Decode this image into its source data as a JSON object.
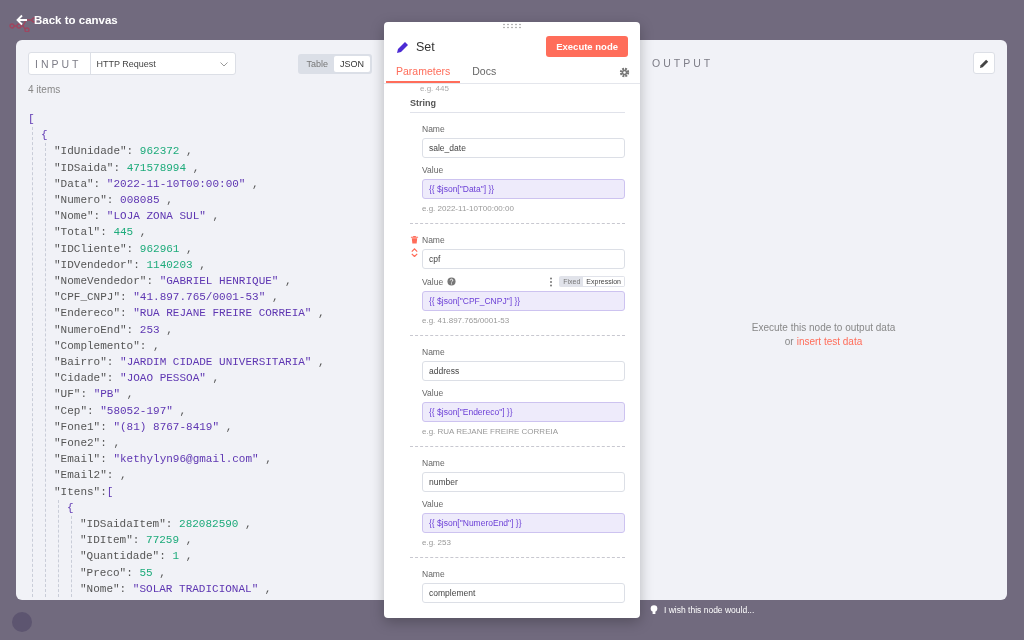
{
  "top_bar": {
    "back_label": "Back to canvas"
  },
  "input": {
    "label": "INPUT",
    "source": "HTTP Request",
    "views": [
      {
        "label": "Table",
        "selected": false
      },
      {
        "label": "JSON",
        "selected": true
      }
    ],
    "count": "4 items",
    "json_view": {
      "open": "[",
      "children": [
        {
          "open": "{",
          "children": [
            {
              "key": "\"IdUnidade\":",
              "value": "962372",
              "kind": "number",
              "comma": ","
            },
            {
              "key": "\"IDSaida\":",
              "value": "471578994",
              "kind": "number",
              "comma": ","
            },
            {
              "key": "\"Data\":",
              "value": "\"2022-11-10T00:00:00\"",
              "kind": "string",
              "comma": ","
            },
            {
              "key": "\"Numero\":",
              "value": "008085",
              "kind": "string",
              "comma": ","
            },
            {
              "key": "\"Nome\":",
              "value": "\"LOJA ZONA SUL\"",
              "kind": "string",
              "comma": ","
            },
            {
              "key": "\"Total\":",
              "value": "445",
              "kind": "number",
              "comma": ","
            },
            {
              "key": "\"IDCliente\":",
              "value": "962961",
              "kind": "number",
              "comma": ","
            },
            {
              "key": "\"IDVendedor\":",
              "value": "1140203",
              "kind": "number",
              "comma": ","
            },
            {
              "key": "\"NomeVendedor\":",
              "value": "\"GABRIEL HENRIQUE\"",
              "kind": "string",
              "comma": ","
            },
            {
              "key": "\"CPF_CNPJ\":",
              "value": "\"41.897.765/0001-53\"",
              "kind": "string",
              "comma": ","
            },
            {
              "key": "\"Endereco\":",
              "value": "\"RUA REJANE FREIRE CORREIA\"",
              "kind": "string",
              "comma": ","
            },
            {
              "key": "\"NumeroEnd\":",
              "value": "253",
              "kind": "string",
              "comma": ","
            },
            {
              "key": "\"Complemento\":",
              "comma": ","
            },
            {
              "key": "\"Bairro\":",
              "value": "\"JARDIM CIDADE UNIVERSITARIA\"",
              "kind": "string",
              "comma": ","
            },
            {
              "key": "\"Cidade\":",
              "value": "\"JOAO PESSOA\"",
              "kind": "string",
              "comma": ","
            },
            {
              "key": "\"UF\":",
              "value": "\"PB\"",
              "kind": "string",
              "comma": ","
            },
            {
              "key": "\"Cep\":",
              "value": "\"58052-197\"",
              "kind": "string",
              "comma": ","
            },
            {
              "key": "\"Fone1\":",
              "value": "\"(81) 8767-8419\"",
              "kind": "string",
              "comma": ","
            },
            {
              "key": "\"Fone2\":",
              "comma": ","
            },
            {
              "key": "\"Email\":",
              "value": "\"kethylyn96@gmail.com\"",
              "kind": "string",
              "comma": ","
            },
            {
              "key": "\"Email2\":",
              "comma": ","
            },
            {
              "key": "\"Itens\":",
              "open": "[",
              "children": [
                {
                  "open": "{",
                  "children": [
                    {
                      "key": "\"IDSaidaItem\":",
                      "value": "282082590",
                      "kind": "number",
                      "comma": ","
                    },
                    {
                      "key": "\"IDItem\":",
                      "value": "77259",
                      "kind": "number",
                      "comma": ","
                    },
                    {
                      "key": "\"Quantidade\":",
                      "value": "1",
                      "kind": "number",
                      "comma": ","
                    },
                    {
                      "key": "\"Preco\":",
                      "value": "55",
                      "kind": "number",
                      "comma": ","
                    },
                    {
                      "key": "\"Nome\":",
                      "value": "\"SOLAR TRADICIONAL\"",
                      "kind": "string",
                      "comma": ","
                    }
                  ]
                }
              ]
            }
          ]
        }
      ]
    }
  },
  "node": {
    "title": "Set",
    "execute_label": "Execute node",
    "tabs": [
      {
        "label": "Parameters",
        "selected": true
      },
      {
        "label": "Docs",
        "selected": false
      }
    ],
    "clipped_hint": "e.g. 445",
    "section": "String",
    "fields": [
      {
        "hovered": false,
        "name_label": "Name",
        "name": "sale_date",
        "value_label": "Value",
        "value": "{{ $json[\"Data\"] }}",
        "hint": "e.g. 2022-11-10T00:00:00"
      },
      {
        "hovered": true,
        "name_label": "Name",
        "name": "cpf",
        "value_label": "Value",
        "value": "{{ $json[\"CPF_CNPJ\"] }}",
        "hint": "e.g. 41.897.765/0001-53",
        "modes": [
          {
            "label": "Fixed",
            "selected": false
          },
          {
            "label": "Expression",
            "selected": true
          }
        ]
      },
      {
        "hovered": false,
        "name_label": "Name",
        "name": "address",
        "value_label": "Value",
        "value": "{{ $json[\"Endereco\"] }}",
        "hint": "e.g. RUA REJANE FREIRE CORREIA"
      },
      {
        "hovered": false,
        "name_label": "Name",
        "name": "number",
        "value_label": "Value",
        "value": "{{ $json[\"NumeroEnd\"] }}",
        "hint": "e.g. 253"
      },
      {
        "hovered": false,
        "name_label": "Name",
        "name": "complement"
      }
    ]
  },
  "output": {
    "label": "OUTPUT",
    "message": "Execute this node to output data",
    "link_prefix": "or",
    "link": "insert test data"
  },
  "feedback": "I wish this node would..."
}
